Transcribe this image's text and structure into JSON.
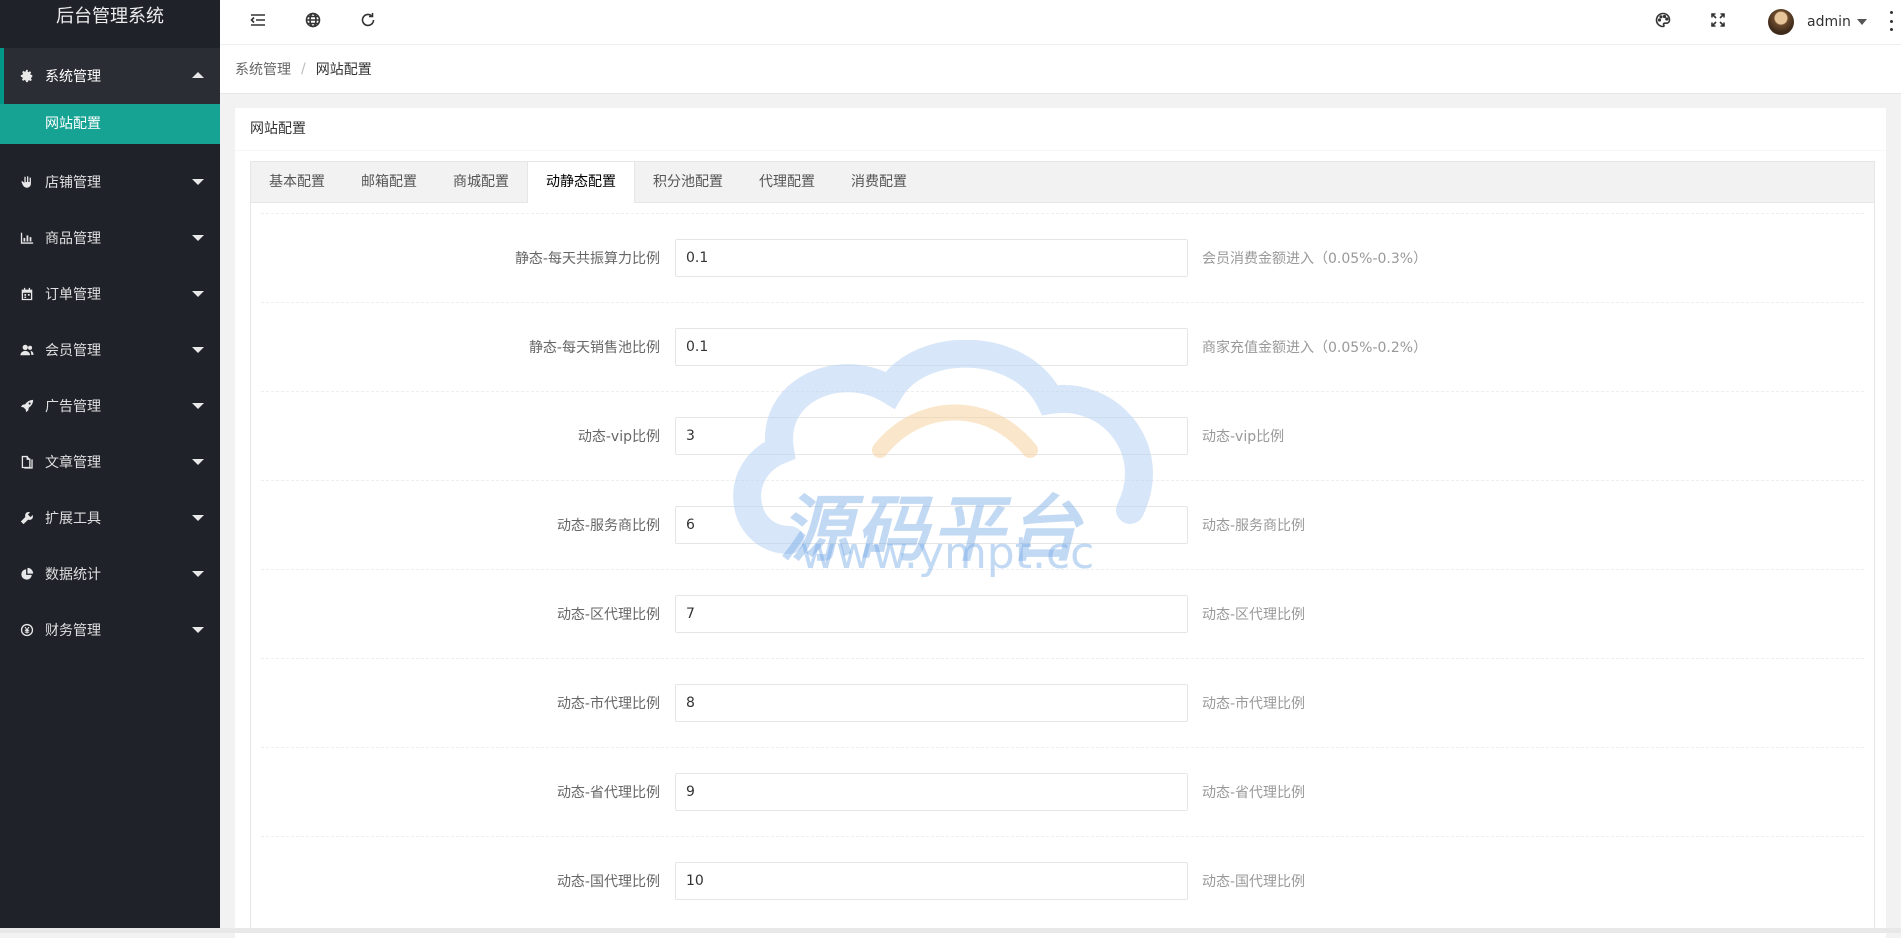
{
  "app": {
    "title": "后台管理系统"
  },
  "sidebar": {
    "items": [
      {
        "label": "系统管理",
        "icon": "gear-icon",
        "open": true,
        "children": [
          {
            "label": "网站配置",
            "active": true
          }
        ]
      },
      {
        "label": "店铺管理",
        "icon": "hand-icon"
      },
      {
        "label": "商品管理",
        "icon": "bar-chart-icon"
      },
      {
        "label": "订单管理",
        "icon": "calendar-icon"
      },
      {
        "label": "会员管理",
        "icon": "users-icon"
      },
      {
        "label": "广告管理",
        "icon": "rocket-icon"
      },
      {
        "label": "文章管理",
        "icon": "documents-icon"
      },
      {
        "label": "扩展工具",
        "icon": "wrench-icon"
      },
      {
        "label": "数据统计",
        "icon": "pie-chart-icon"
      },
      {
        "label": "财务管理",
        "icon": "yen-icon"
      }
    ]
  },
  "header": {
    "left_icons": [
      "menu-fold-icon",
      "globe-icon",
      "refresh-icon"
    ],
    "right_icons": [
      "palette-icon",
      "fullscreen-icon"
    ],
    "user": {
      "name": "admin"
    }
  },
  "breadcrumb": {
    "parent": "系统管理",
    "separator": "/",
    "current": "网站配置"
  },
  "card": {
    "title": "网站配置"
  },
  "tabs": {
    "items": [
      "基本配置",
      "邮箱配置",
      "商城配置",
      "动静态配置",
      "积分池配置",
      "代理配置",
      "消费配置"
    ],
    "active_index": 3
  },
  "form": {
    "rows": [
      {
        "label": "静态-每天共振算力比例",
        "value": "0.1",
        "hint": "会员消费金额进入（0.05%-0.3%）"
      },
      {
        "label": "静态-每天销售池比例",
        "value": "0.1",
        "hint": "商家充值金额进入（0.05%-0.2%）"
      },
      {
        "label": "动态-vip比例",
        "value": "3",
        "hint": "动态-vip比例"
      },
      {
        "label": "动态-服务商比例",
        "value": "6",
        "hint": "动态-服务商比例"
      },
      {
        "label": "动态-区代理比例",
        "value": "7",
        "hint": "动态-区代理比例"
      },
      {
        "label": "动态-市代理比例",
        "value": "8",
        "hint": "动态-市代理比例"
      },
      {
        "label": "动态-省代理比例",
        "value": "9",
        "hint": "动态-省代理比例"
      },
      {
        "label": "动态-国代理比例",
        "value": "10",
        "hint": "动态-国代理比例"
      }
    ]
  },
  "watermark": {
    "text": "源码平台",
    "url": "www.ympt.cc"
  },
  "colors": {
    "sidebar_bg": "#20222a",
    "accent": "#009688",
    "active_sub_bg": "#16a394"
  }
}
